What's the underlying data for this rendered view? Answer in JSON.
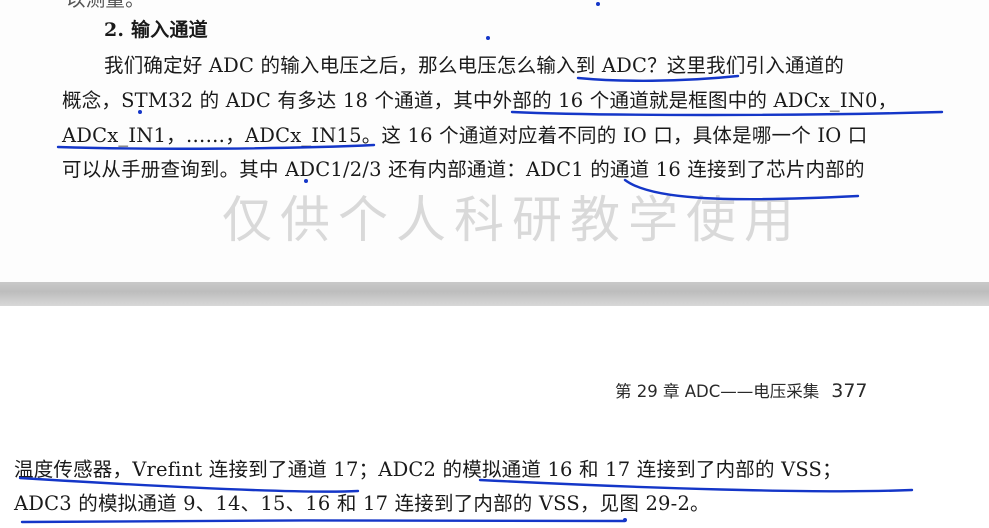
{
  "page_top": {
    "cut_line": "以测量。",
    "heading": "2. 输入通道",
    "lines": [
      "我们确定好 ADC 的输入电压之后，那么电压怎么输入到 ADC？这里我们引入通道的",
      "概念，STM32 的 ADC 有多达 18 个通道，其中外部的 16 个通道就是框图中的 ADCx_IN0，",
      "ADCx_IN1，……，ADCx_IN15。这 16 个通道对应着不同的 IO 口，具体是哪一个 IO 口",
      "可以从手册查询到。其中 ADC1/2/3 还有内部通道：ADC1 的通道 16 连接到了芯片内部的"
    ],
    "watermark": "仅供个人科研教学使用"
  },
  "page_bottom": {
    "running_header": "第 29 章 ADC——电压采集",
    "page_number": "377",
    "lines": [
      "温度传感器，Vrefint 连接到了通道 17；ADC2 的模拟通道 16 和 17 连接到了内部的 VSS；",
      "ADC3 的模拟通道 9、14、15、16 和 17 连接到了内部的 VSS，见图 29-2。"
    ]
  },
  "annotation_color": "#1436c8"
}
